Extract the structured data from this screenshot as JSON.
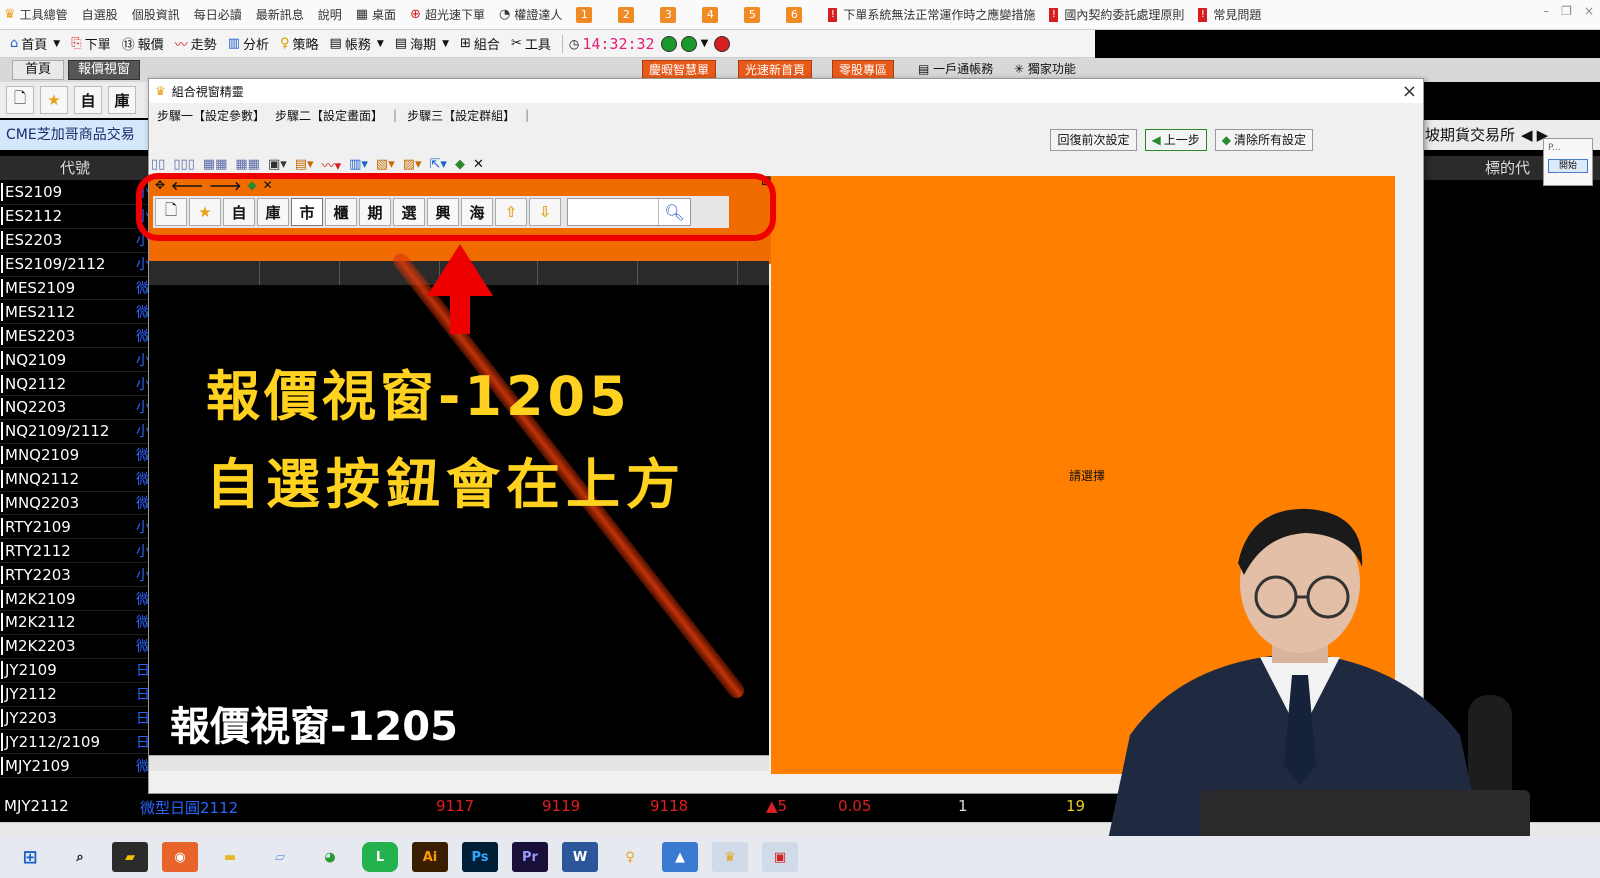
{
  "menubar": {
    "items": [
      "工具總管",
      "自選股",
      "個股資訊",
      "每日必讀",
      "最新訊息",
      "說明",
      "桌面",
      "超光速下單",
      "權證達人"
    ],
    "numbers": [
      "1",
      "2",
      "3",
      "4",
      "5",
      "6"
    ],
    "notices": [
      "下單系統無法正常運作時之應變措施",
      "國內契約委託處理原則",
      "常見問題"
    ]
  },
  "toolbar": {
    "items": [
      "首頁",
      "下單",
      "報價",
      "走勢",
      "分析",
      "策略",
      "帳務",
      "海期",
      "組合",
      "工具"
    ],
    "clock": "14:32:32"
  },
  "tabs": {
    "home": "首頁",
    "quote": "報價視窗"
  },
  "quick_links": [
    "慶暇智慧單",
    "光速新首頁",
    "零股專區",
    "一戶通帳務",
    "獨家功能"
  ],
  "left_bg": {
    "icons": [
      "自",
      "庫"
    ],
    "banner": "CME芝加哥商品交易",
    "code_header": "代號",
    "codes": [
      "ES2109",
      "ES2112",
      "ES2203",
      "ES2109/2112",
      "MES2109",
      "MES2112",
      "MES2203",
      "NQ2109",
      "NQ2112",
      "NQ2203",
      "NQ2109/2112",
      "MNQ2109",
      "MNQ2112",
      "MNQ2203",
      "RTY2109",
      "RTY2112",
      "RTY2203",
      "M2K2109",
      "M2K2112",
      "M2K2203",
      "JY2109",
      "JY2112",
      "JY2203",
      "JY2112/2109",
      "MJY2109"
    ],
    "name_chars": [
      "小",
      "小",
      "小",
      "小",
      "微",
      "微",
      "微",
      "小",
      "小",
      "小",
      "小",
      "微",
      "微",
      "微",
      "小",
      "小",
      "小",
      "微",
      "微",
      "微",
      "日",
      "日",
      "日",
      "日",
      "微"
    ],
    "bottom_row": {
      "code": "MJY2112",
      "name": "微型日圓2112",
      "v1": "9117",
      "v2": "9119",
      "v3": "9118",
      "change": "▲5",
      "pct": "0.05",
      "vol": "1",
      "total": "19"
    }
  },
  "right_bg": {
    "banner": "坡期貨交易所",
    "header": "標的代",
    "pop_label": "P...",
    "pop_btn": "開始"
  },
  "dialog": {
    "title": "組合視窗精靈",
    "steps": [
      "步驟一【設定參數】",
      "步驟二【設定畫面】",
      "步驟三【設定群組】"
    ],
    "buttons": {
      "restore": "回復前次設定",
      "prev": "上一步",
      "clear": "清除所有設定"
    },
    "strip_buttons": [
      "自",
      "庫",
      "市",
      "櫃",
      "期",
      "選",
      "興",
      "海"
    ],
    "search_value": "",
    "please_choose": "請選擇"
  },
  "overlay": {
    "line1": "報價視窗-1205",
    "line2": "自選按鈕會在上方",
    "caption": "報價視窗-1205"
  },
  "taskbar": {
    "apps": [
      "Ai",
      "Ps",
      "Pr"
    ]
  },
  "colors": {
    "accent_orange": "#ff8000",
    "annotation_red": "#e00000",
    "highlight_yellow": "#ffd21f"
  }
}
